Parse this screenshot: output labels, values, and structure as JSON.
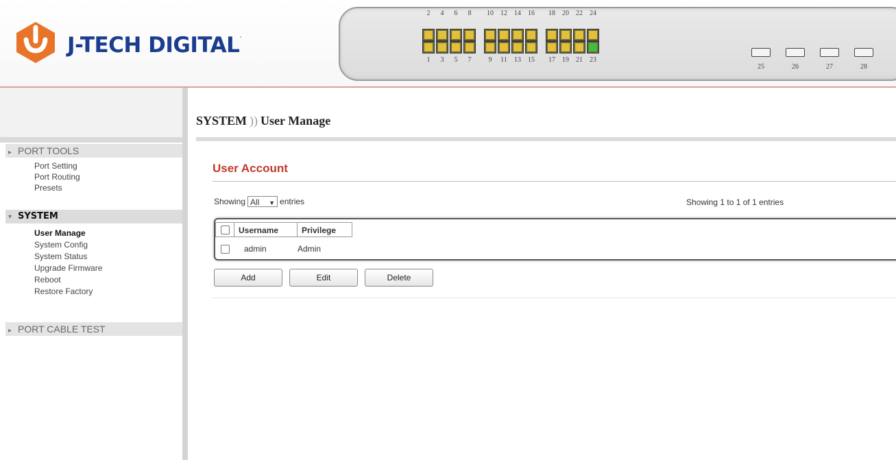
{
  "brand": {
    "name": "J-TECH DIGITAL",
    "tm": "."
  },
  "switch": {
    "top_ports": [
      "2",
      "4",
      "6",
      "8",
      "10",
      "12",
      "14",
      "16",
      "18",
      "20",
      "22",
      "24"
    ],
    "bottom_ports": [
      "1",
      "3",
      "5",
      "7",
      "9",
      "11",
      "13",
      "15",
      "17",
      "19",
      "21",
      "23"
    ],
    "active_port": "23",
    "sfp_ports": [
      "25",
      "26",
      "27",
      "28"
    ],
    "colors": {
      "led_amber": "#e3bf3a",
      "led_green": "#3fbf3f"
    }
  },
  "sidebar": {
    "sections": [
      {
        "label": "PORT TOOLS",
        "items": [
          "Port Setting",
          "Port Routing",
          "Presets"
        ]
      },
      {
        "label": "SYSTEM",
        "items": [
          "User Manage",
          "System Config",
          "System Status",
          "Upgrade Firmware",
          "Reboot",
          "Restore Factory"
        ]
      },
      {
        "label": "PORT CABLE TEST",
        "items": []
      }
    ],
    "current_item": "User Manage"
  },
  "breadcrumb": {
    "section": "SYSTEM",
    "separator": "))",
    "page": "User Manage"
  },
  "panel": {
    "title": "User Account",
    "showing_prefix": "Showing",
    "showing_select": "All",
    "showing_suffix": "entries",
    "showing_summary": "Showing 1 to 1 of 1 entries",
    "table": {
      "headers": [
        "Username",
        "Privilege"
      ],
      "rows": [
        {
          "username": "admin",
          "privilege": "Admin"
        }
      ]
    },
    "buttons": {
      "add": "Add",
      "edit": "Edit",
      "delete": "Delete"
    }
  },
  "colors": {
    "title_red": "#c0392b",
    "brand_blue": "#1a3d8f",
    "brand_orange": "#e8742a"
  }
}
